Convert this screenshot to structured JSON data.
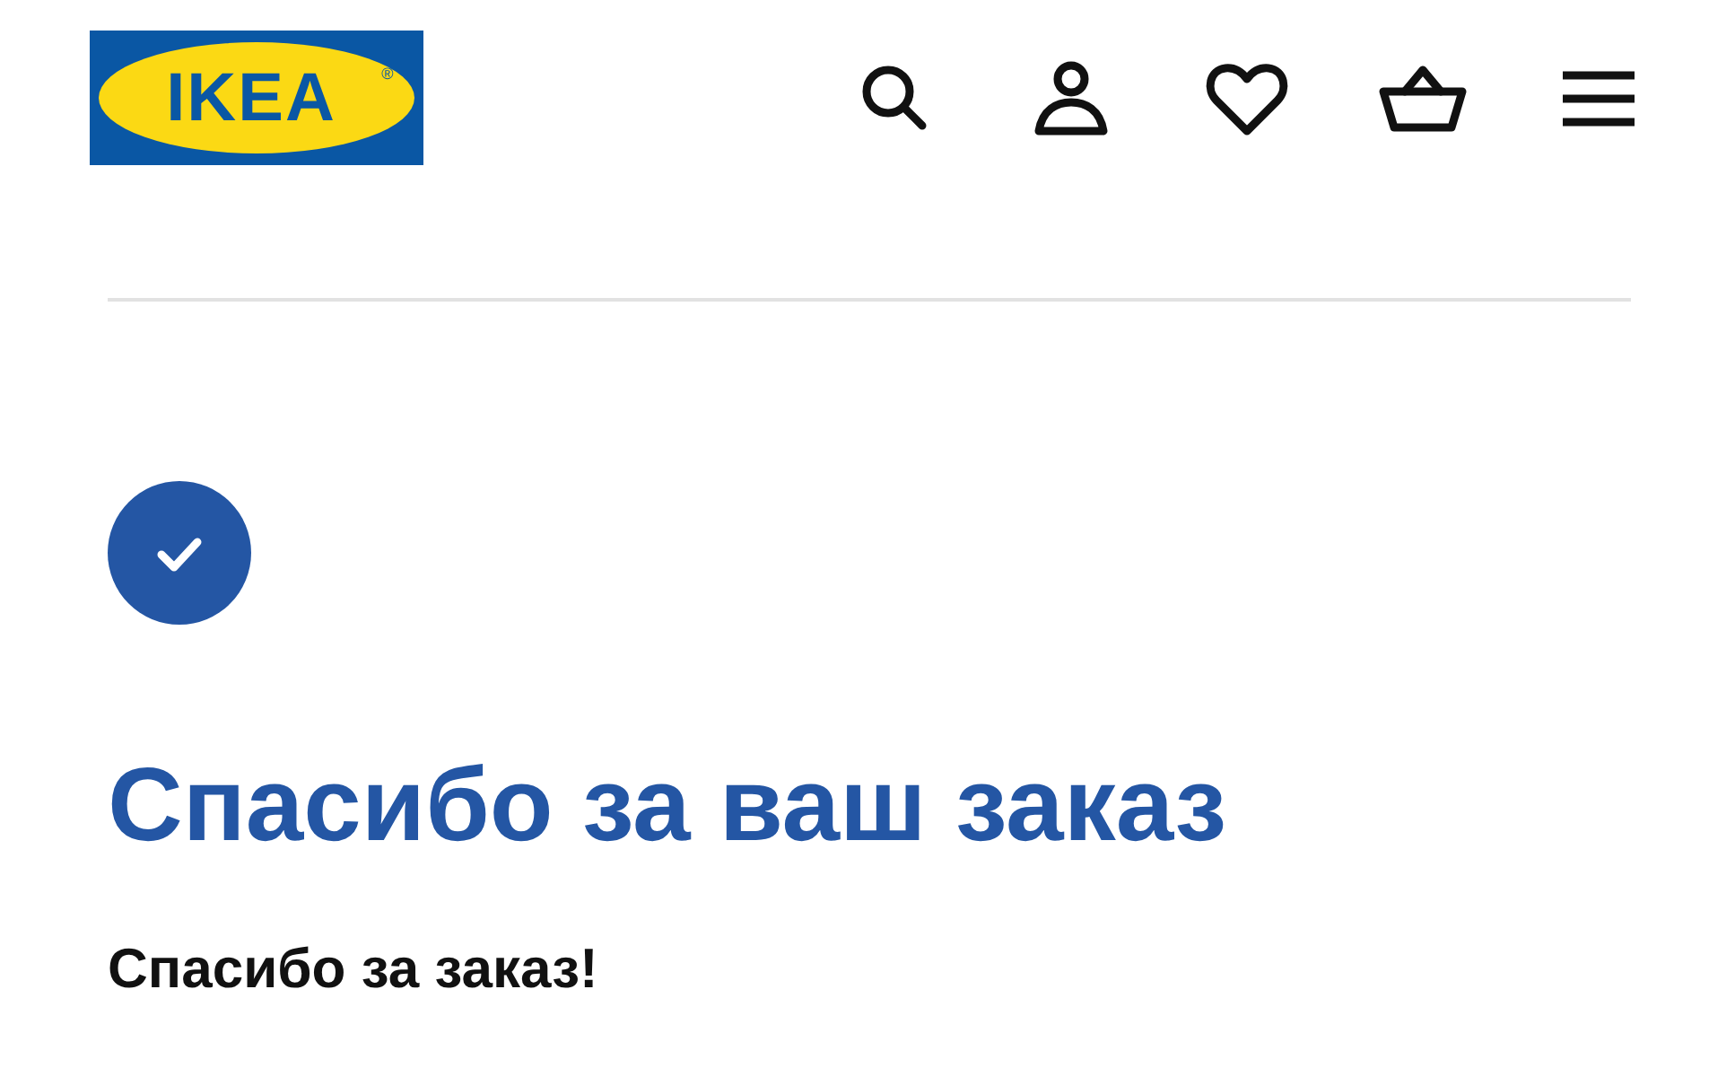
{
  "logo": {
    "text": "IKEA",
    "mark": "®"
  },
  "heading": "Спасибо за ваш заказ",
  "subheading": "Спасибо за заказ!"
}
